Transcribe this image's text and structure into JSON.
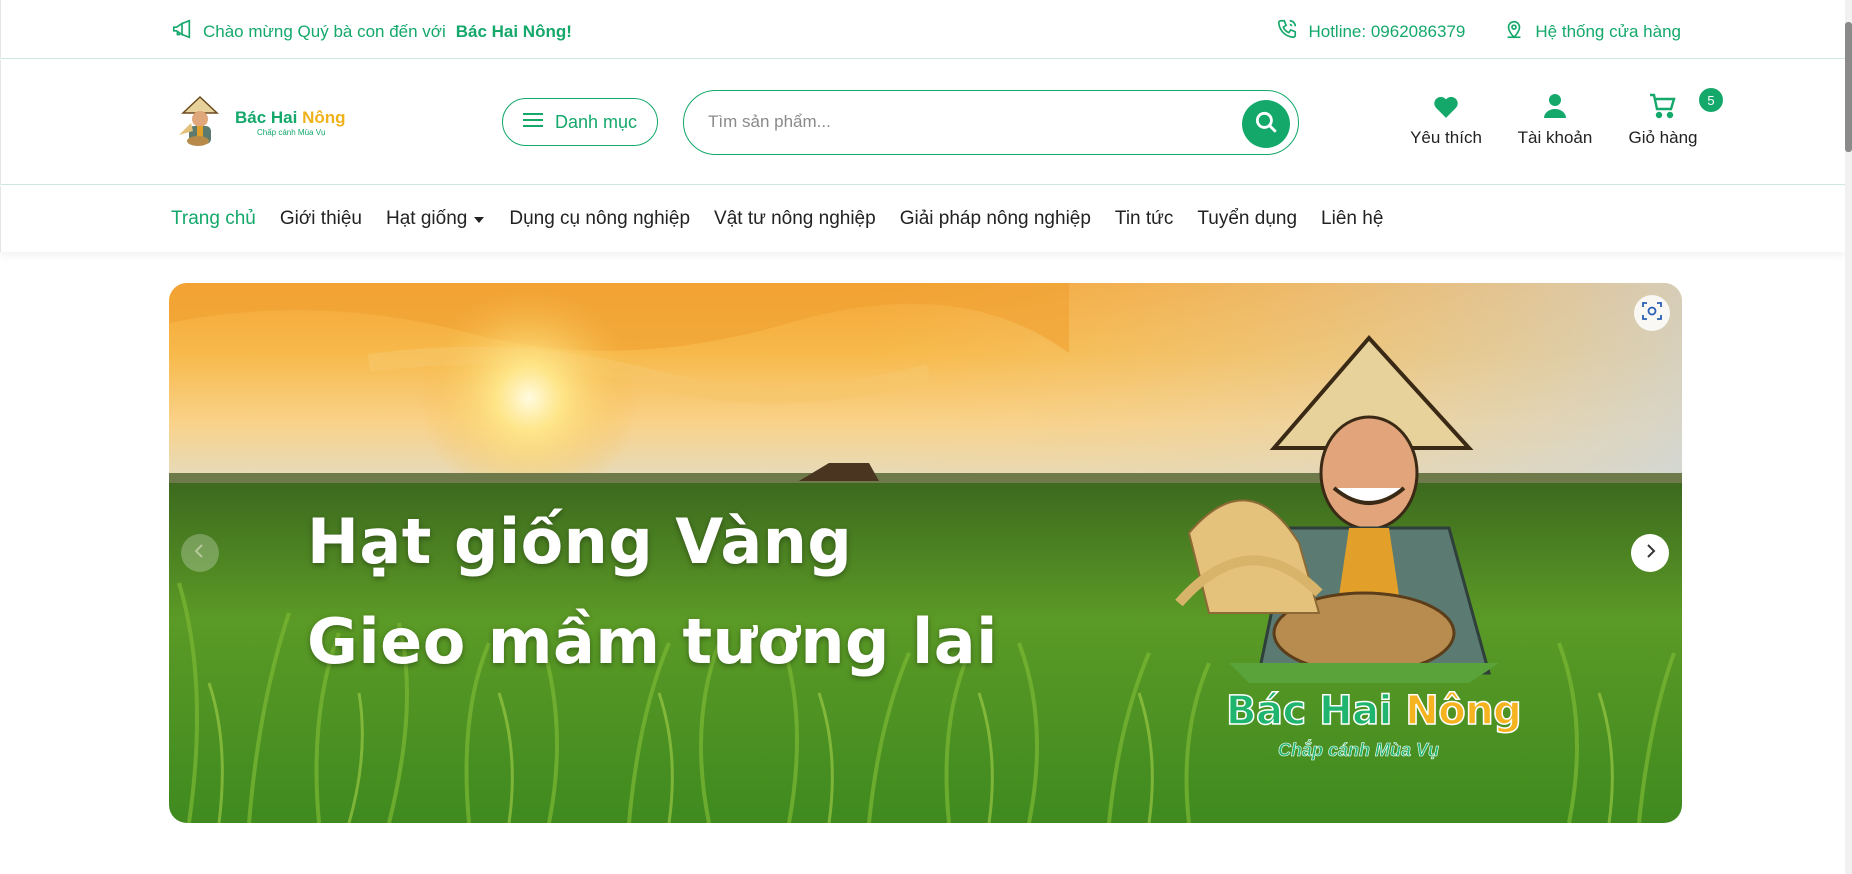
{
  "topbar": {
    "welcome_prefix": "Chào mừng Quý bà con đến với",
    "welcome_brand": "Bác Hai Nông!",
    "hotline": "Hotline: 0962086379",
    "stores": "Hệ thống cửa hàng"
  },
  "header": {
    "logo_name_main": "Bác Hai",
    "logo_name_accent": "Nông",
    "logo_tagline": "Chấp cánh Mùa Vụ",
    "category_button": "Danh mục",
    "search_placeholder": "Tìm sản phẩm...",
    "icons": {
      "wishlist": "Yêu thích",
      "account": "Tài khoản",
      "cart": "Giỏ hàng",
      "cart_count": "5"
    }
  },
  "nav": {
    "items": [
      "Trang chủ",
      "Giới thiệu",
      "Hạt giống",
      "Dụng cụ nông nghiệp",
      "Vật tư nông nghiệp",
      "Giải pháp nông nghiệp",
      "Tin tức",
      "Tuyển dụng",
      "Liên hệ"
    ],
    "active": "Trang chủ"
  },
  "banner": {
    "line1": "Hạt giống Vàng",
    "line2": "Gieo mầm tương lai",
    "brand_main": "Bác Hai",
    "brand_accent": "Nông",
    "brand_tagline": "Chắp cánh Mùa Vụ"
  },
  "colors": {
    "accent": "#14a86b",
    "brand_yellow": "#f0b21a"
  }
}
